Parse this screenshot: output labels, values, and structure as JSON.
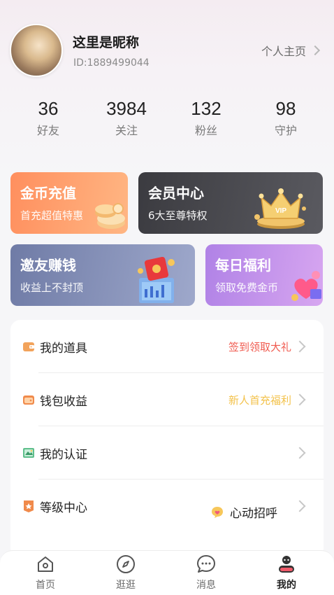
{
  "profile": {
    "nickname": "这里是昵称",
    "id_text": "ID:1889499044",
    "homepage_link": "个人主页"
  },
  "stats": [
    {
      "value": "36",
      "label": "好友"
    },
    {
      "value": "3984",
      "label": "关注"
    },
    {
      "value": "132",
      "label": "粉丝"
    },
    {
      "value": "98",
      "label": "守护"
    }
  ],
  "cards": {
    "recharge": {
      "title": "金币充值",
      "subtitle": "首充超值特惠"
    },
    "vip": {
      "title": "会员中心",
      "subtitle": "6大至尊特权",
      "badge": "VIP"
    },
    "invite": {
      "title": "邀友赚钱",
      "subtitle": "收益上不封顶"
    },
    "daily": {
      "title": "每日福利",
      "subtitle": "领取免费金币"
    }
  },
  "menu": {
    "items": [
      {
        "label": "我的道具",
        "hint": "签到领取大礼",
        "hint_color": "#f05a4f",
        "icon": "wallet-icon"
      },
      {
        "label": "钱包收益",
        "hint": "新人首充福利",
        "hint_color": "#f3c24b",
        "icon": "purse-icon"
      },
      {
        "label": "我的认证",
        "hint": "",
        "icon": "certificate-icon"
      },
      {
        "label": "等级中心",
        "hint": "",
        "icon": "badge-icon"
      }
    ],
    "greet_label": "心动招呼"
  },
  "tabbar": {
    "tabs": [
      {
        "label": "首页",
        "icon": "home-icon"
      },
      {
        "label": "逛逛",
        "icon": "compass-icon"
      },
      {
        "label": "消息",
        "icon": "message-icon"
      },
      {
        "label": "我的",
        "icon": "profile-icon",
        "active": true
      }
    ]
  }
}
